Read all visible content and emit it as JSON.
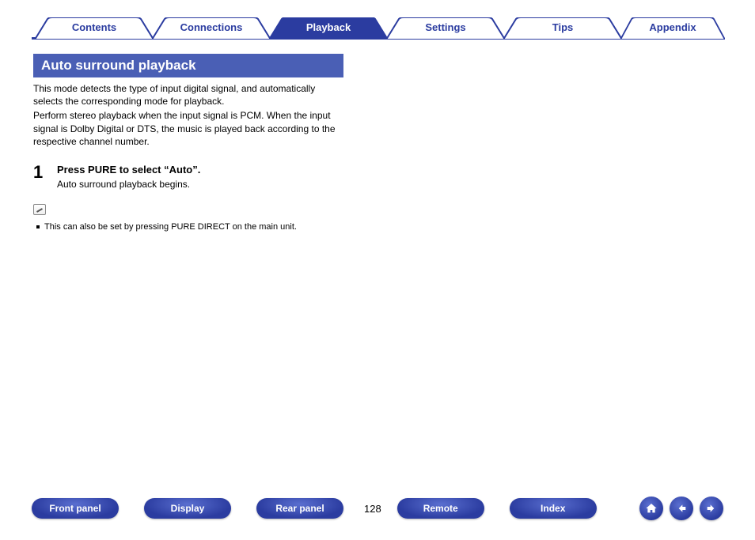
{
  "tabs": [
    {
      "label": "Contents",
      "active": false
    },
    {
      "label": "Connections",
      "active": false
    },
    {
      "label": "Playback",
      "active": true
    },
    {
      "label": "Settings",
      "active": false
    },
    {
      "label": "Tips",
      "active": false
    },
    {
      "label": "Appendix",
      "active": false
    }
  ],
  "section": {
    "title": "Auto surround playback",
    "para1": "This mode detects the type of input digital signal, and automatically selects the corresponding mode for playback.",
    "para2": "Perform stereo playback when the input signal is PCM. When the input signal is Dolby Digital or DTS, the music is played back according to the respective channel number."
  },
  "step": {
    "num": "1",
    "title": "Press PURE to select “Auto”.",
    "desc": "Auto surround playback begins."
  },
  "note": "This can also be set by pressing PURE DIRECT on the main unit.",
  "bottom": {
    "buttons": [
      "Front panel",
      "Display",
      "Rear panel",
      "Remote",
      "Index"
    ],
    "page": "128"
  }
}
